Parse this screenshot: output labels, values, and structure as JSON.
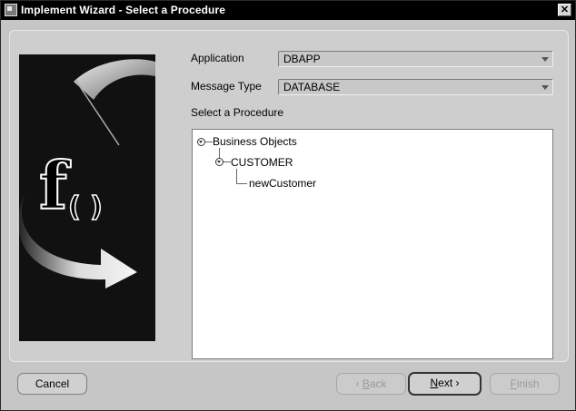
{
  "window": {
    "title": "Implement Wizard - Select a Procedure",
    "close_glyph": "✕"
  },
  "form": {
    "application_label": "Application",
    "application_value": "DBAPP",
    "message_type_label": "Message Type",
    "message_type_value": "DATABASE",
    "procedure_label": "Select a Procedure"
  },
  "tree": {
    "root": "Business Objects",
    "child": "CUSTOMER",
    "leaf": "newCustomer"
  },
  "buttons": {
    "cancel": "Cancel",
    "back_mnemonic": "B",
    "back_rest": "ack",
    "back_arrow": "‹",
    "next_mnemonic": "N",
    "next_rest": "ext",
    "next_arrow": "›",
    "finish_mnemonic": "F",
    "finish_rest": "inish"
  }
}
